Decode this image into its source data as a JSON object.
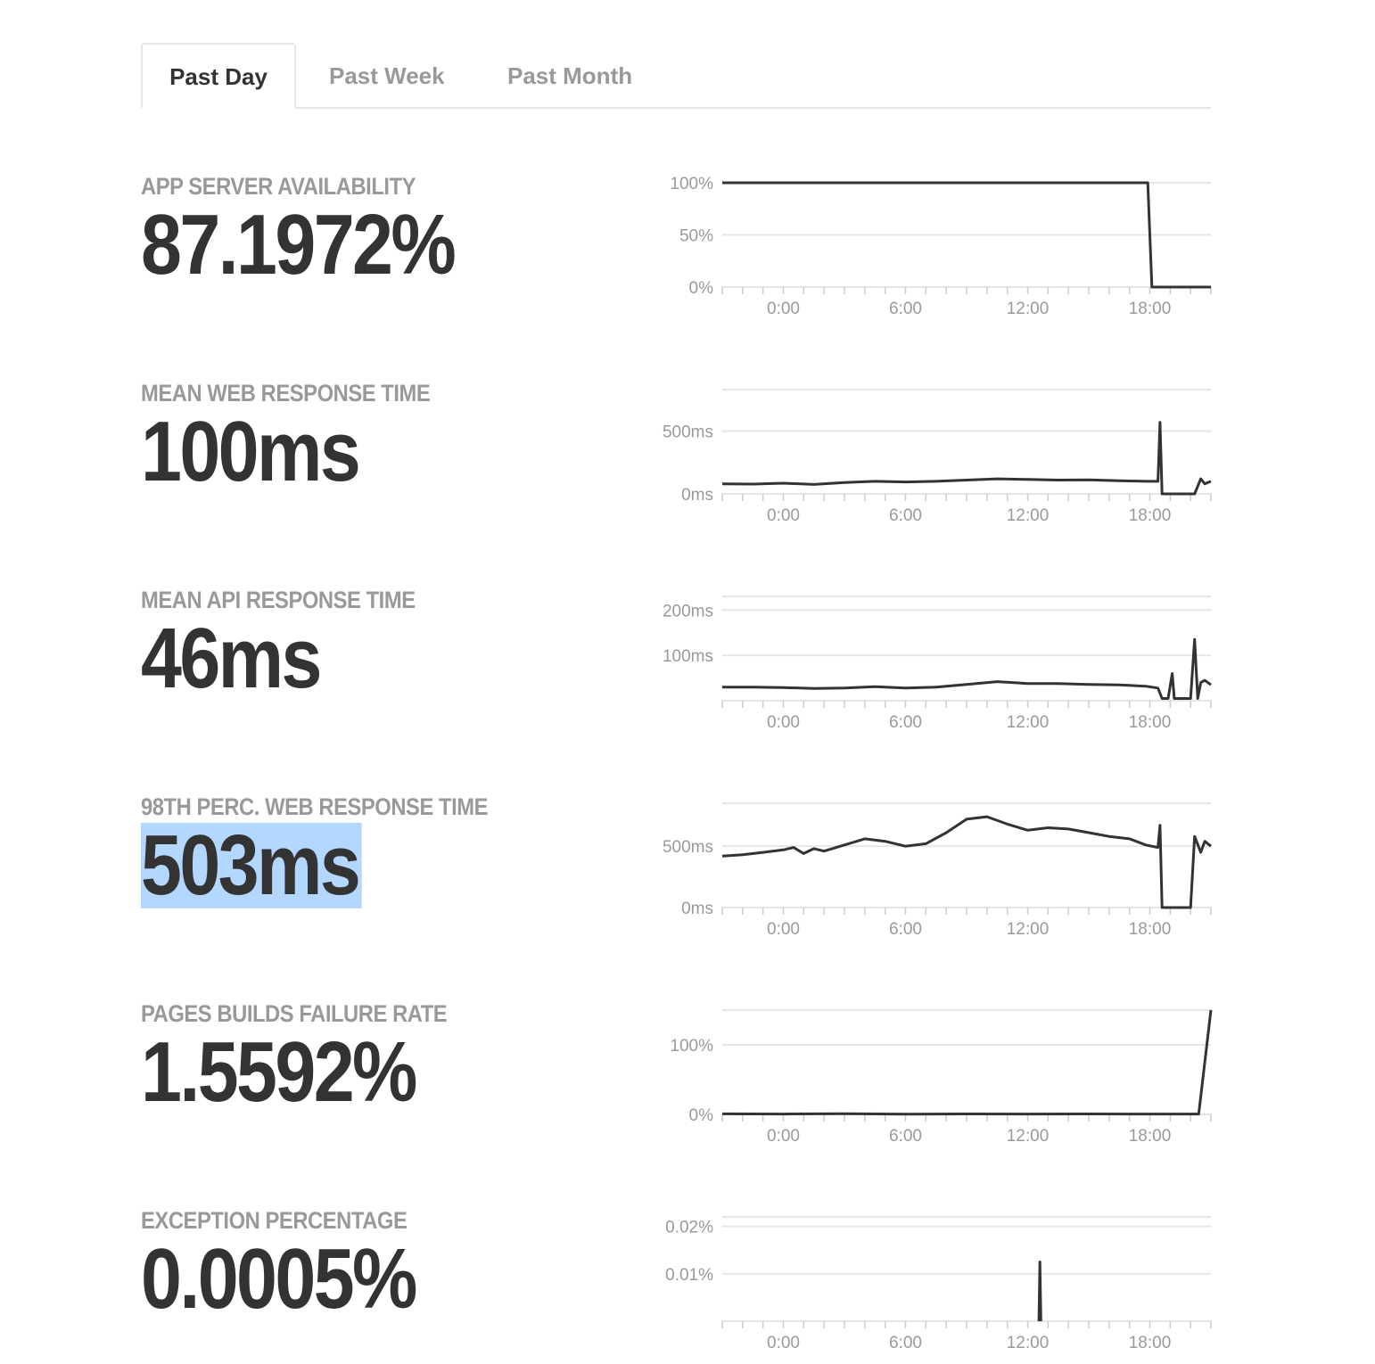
{
  "tabs": [
    {
      "label": "Past Day",
      "active": true
    },
    {
      "label": "Past Week",
      "active": false
    },
    {
      "label": "Past Month",
      "active": false
    }
  ],
  "colors": {
    "line": "#333333",
    "grid": "#e6e6e6",
    "muted": "#999999",
    "selection": "#b3d7ff"
  },
  "metrics": [
    {
      "label": "APP SERVER AVAILABILITY",
      "value": "87.1972%"
    },
    {
      "label": "MEAN WEB RESPONSE TIME",
      "value": "100ms"
    },
    {
      "label": "MEAN API RESPONSE TIME",
      "value": "46ms"
    },
    {
      "label": "98TH PERC. WEB RESPONSE TIME",
      "value": "503ms"
    },
    {
      "label": "PAGES BUILDS FAILURE RATE",
      "value": "1.5592%"
    },
    {
      "label": "EXCEPTION PERCENTAGE",
      "value": "0.0005%"
    }
  ],
  "chart_data": [
    {
      "type": "line",
      "x_ticks": [
        "0:00",
        "6:00",
        "12:00",
        "18:00"
      ],
      "y_ticks": [
        "0%",
        "50%",
        "100%"
      ],
      "ylim": [
        0,
        100
      ],
      "x": [
        -3,
        17.9,
        18.1,
        21.0
      ],
      "y": [
        100,
        100,
        0,
        0
      ]
    },
    {
      "type": "line",
      "x_ticks": [
        "0:00",
        "6:00",
        "12:00",
        "18:00"
      ],
      "y_ticks": [
        "0ms",
        "500ms"
      ],
      "ylim": [
        0,
        830
      ],
      "x": [
        -3,
        -1.5,
        0,
        1.5,
        3,
        4.5,
        6,
        7.5,
        9,
        10.5,
        12,
        13.5,
        15,
        16.5,
        17.8,
        18.4,
        18.5,
        18.6,
        18.7,
        20.2,
        20.5,
        20.7,
        21.0
      ],
      "y": [
        80,
        78,
        85,
        75,
        90,
        100,
        95,
        100,
        110,
        120,
        115,
        110,
        112,
        105,
        100,
        100,
        570,
        0,
        0,
        0,
        120,
        80,
        100
      ]
    },
    {
      "type": "line",
      "x_ticks": [
        "0:00",
        "6:00",
        "12:00",
        "18:00"
      ],
      "y_ticks": [
        "100ms",
        "200ms"
      ],
      "ylim": [
        0,
        230
      ],
      "x": [
        -3,
        -1.5,
        0,
        1.5,
        3,
        4.5,
        6,
        7.5,
        9,
        10.5,
        12,
        13.5,
        15,
        16.5,
        17.8,
        18.4,
        18.6,
        18.9,
        19.1,
        19.2,
        19.5,
        20.0,
        20.2,
        20.35,
        20.5,
        20.7,
        21.0
      ],
      "y": [
        30,
        30,
        29,
        27,
        28,
        31,
        28,
        30,
        36,
        42,
        38,
        38,
        36,
        35,
        32,
        28,
        5,
        5,
        60,
        5,
        5,
        5,
        135,
        5,
        40,
        45,
        35
      ]
    },
    {
      "type": "line",
      "x_ticks": [
        "0:00",
        "6:00",
        "12:00",
        "18:00"
      ],
      "y_ticks": [
        "0ms",
        "500ms"
      ],
      "ylim": [
        0,
        850
      ],
      "x": [
        -3,
        -2,
        -1,
        0,
        0.5,
        1,
        1.5,
        2,
        3,
        4,
        5,
        6,
        7,
        8,
        9,
        10,
        11,
        12,
        13,
        14,
        15,
        16,
        17,
        17.8,
        18.4,
        18.5,
        18.6,
        20.0,
        20.2,
        20.5,
        20.7,
        21.0
      ],
      "y": [
        420,
        430,
        450,
        470,
        490,
        440,
        480,
        460,
        510,
        560,
        540,
        500,
        520,
        610,
        720,
        740,
        680,
        630,
        650,
        640,
        610,
        580,
        560,
        510,
        490,
        670,
        0,
        0,
        580,
        450,
        540,
        500
      ]
    },
    {
      "type": "line",
      "x_ticks": [
        "0:00",
        "6:00",
        "12:00",
        "18:00"
      ],
      "y_ticks": [
        "0%",
        "100%"
      ],
      "ylim": [
        0,
        150
      ],
      "x": [
        -3,
        0,
        3,
        6,
        9,
        12,
        15,
        18,
        20.2,
        20.4,
        21.0
      ],
      "y": [
        0.8,
        0.5,
        0.9,
        0.4,
        0.7,
        0.5,
        0.6,
        0.5,
        0.5,
        0.5,
        150
      ]
    },
    {
      "type": "line",
      "x_ticks": [
        "0:00",
        "6:00",
        "12:00",
        "18:00"
      ],
      "y_ticks": [
        "0.01%",
        "0.02%"
      ],
      "ylim": [
        0,
        0.022
      ],
      "x": [
        12.55,
        12.6,
        12.65
      ],
      "y": [
        0,
        0.0125,
        0
      ]
    }
  ]
}
